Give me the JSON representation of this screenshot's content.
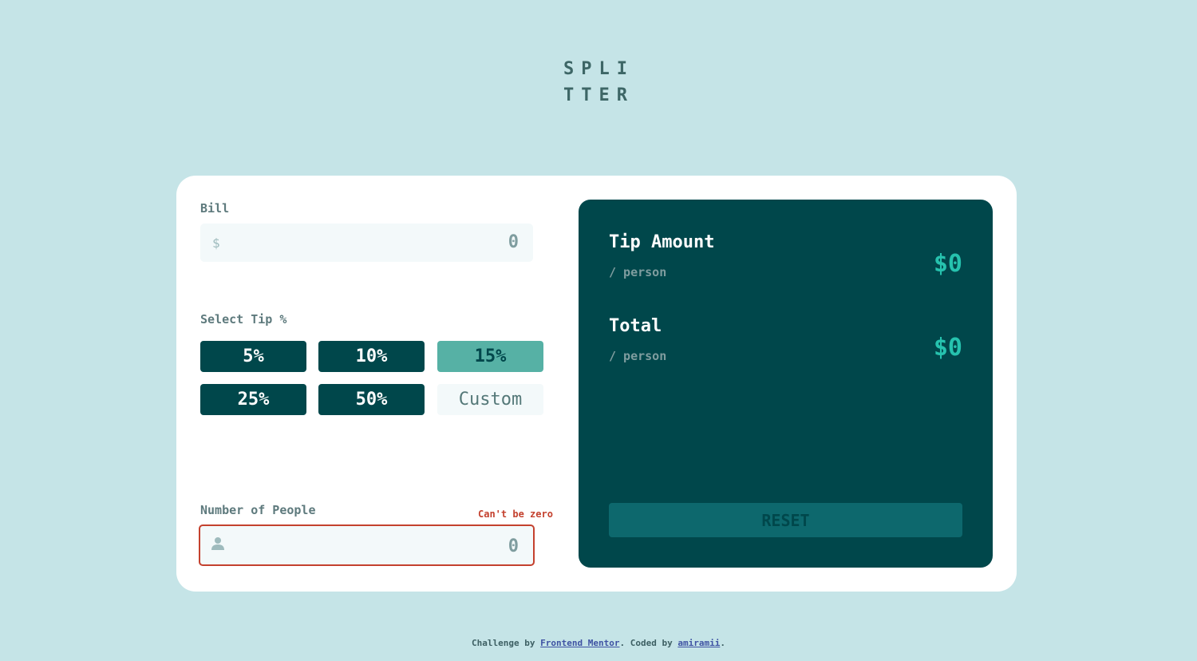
{
  "logo": {
    "line1": "SPLI",
    "line2": "TTER"
  },
  "bill": {
    "label": "Bill",
    "currency_symbol": "$",
    "value": "0"
  },
  "tip": {
    "label": "Select Tip %",
    "options": [
      "5%",
      "10%",
      "15%",
      "25%",
      "50%"
    ],
    "selected": "15%",
    "custom_placeholder": "Custom"
  },
  "people": {
    "label": "Number of People",
    "error": "Can't be zero",
    "value": "0"
  },
  "results": {
    "tip_amount_title": "Tip Amount",
    "tip_amount_sub": "/ person",
    "tip_amount_value": "$0",
    "total_title": "Total",
    "total_sub": "/ person",
    "total_value": "$0",
    "reset_label": "RESET"
  },
  "footer": {
    "prefix": "Challenge by ",
    "link1": "Frontend Mentor",
    "middle": ". Coded by ",
    "link2": "amiramii",
    "suffix": "."
  },
  "colors": {
    "background": "#c5e4e7",
    "dark_cyan": "#00474b",
    "accent": "#26c2ae",
    "error": "#c4412e"
  }
}
